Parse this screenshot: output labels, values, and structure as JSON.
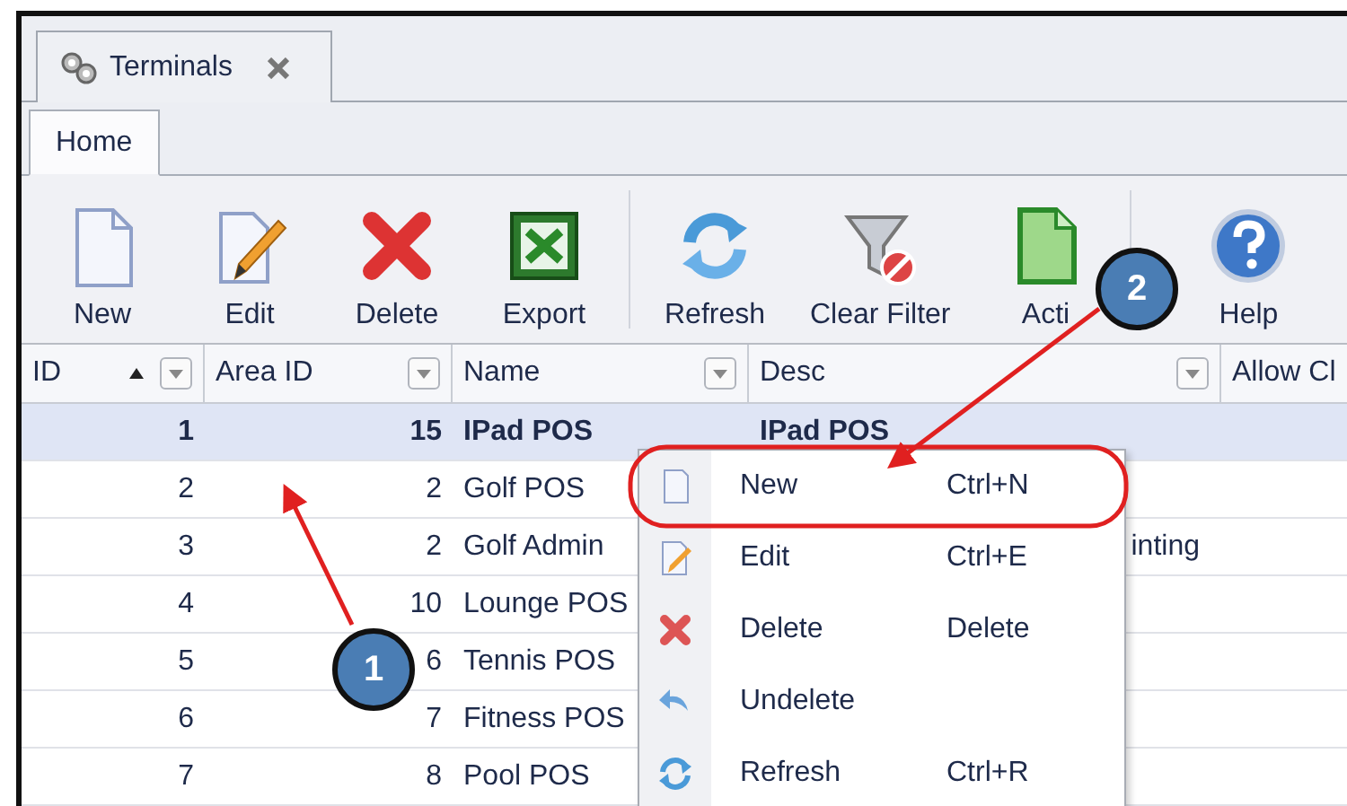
{
  "document_tab": {
    "label": "Terminals"
  },
  "ribbon_tabs": [
    {
      "label": "Home",
      "selected": true
    }
  ],
  "toolbar": [
    {
      "kind": "new",
      "label": "New"
    },
    {
      "kind": "edit",
      "label": "Edit"
    },
    {
      "kind": "delete",
      "label": "Delete"
    },
    {
      "kind": "export",
      "label": "Export"
    },
    {
      "kind": "separator"
    },
    {
      "kind": "refresh",
      "label": "Refresh"
    },
    {
      "kind": "clear_filter",
      "label": "Clear Filter"
    },
    {
      "kind": "active",
      "label": "Acti"
    },
    {
      "kind": "separator"
    },
    {
      "kind": "help",
      "label": "Help"
    }
  ],
  "table": {
    "columns": [
      {
        "label": "ID",
        "sorted": true,
        "filter": true
      },
      {
        "label": "Area ID",
        "sorted": false,
        "filter": true
      },
      {
        "label": "Name",
        "sorted": false,
        "filter": true
      },
      {
        "label": "Desc",
        "sorted": false,
        "filter": true
      },
      {
        "label": "Allow Cl",
        "sorted": false,
        "filter": false
      }
    ],
    "rows": [
      {
        "selected": true,
        "id": "1",
        "area_id": "15",
        "name": "IPad POS",
        "desc": "IPad POS"
      },
      {
        "selected": false,
        "id": "2",
        "area_id": "2",
        "name": "Golf POS"
      },
      {
        "selected": false,
        "id": "3",
        "area_id": "2",
        "name": "Golf Admin",
        "desc": "inting",
        "desc_cut": true
      },
      {
        "selected": false,
        "id": "4",
        "area_id": "10",
        "name": "Lounge POS"
      },
      {
        "selected": false,
        "id": "5",
        "area_id": "6",
        "name": "Tennis POS"
      },
      {
        "selected": false,
        "id": "6",
        "area_id": "7",
        "name": "Fitness POS"
      },
      {
        "selected": false,
        "id": "7",
        "area_id": "8",
        "name": "Pool POS"
      }
    ]
  },
  "context_menu": [
    {
      "kind": "new",
      "label": "New",
      "shortcut": "Ctrl+N"
    },
    {
      "kind": "edit",
      "label": "Edit",
      "shortcut": "Ctrl+E"
    },
    {
      "kind": "delete",
      "label": "Delete",
      "shortcut": "Delete"
    },
    {
      "kind": "undelete",
      "label": "Undelete"
    },
    {
      "kind": "refresh",
      "label": "Refresh",
      "shortcut": "Ctrl+R"
    }
  ],
  "callouts": [
    {
      "number": "1"
    },
    {
      "number": "2"
    }
  ]
}
